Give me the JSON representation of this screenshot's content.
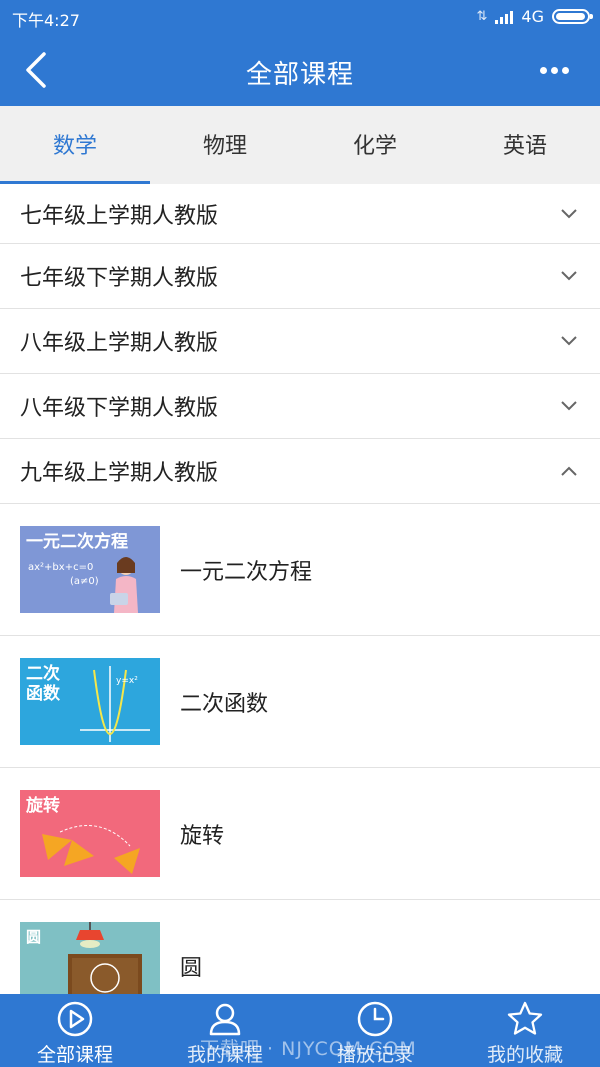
{
  "status": {
    "time": "下午4:27",
    "network": "4G",
    "battery_level": 0.95
  },
  "nav": {
    "title": "全部课程"
  },
  "tabs": [
    {
      "label": "数学",
      "active": true
    },
    {
      "label": "物理",
      "active": false
    },
    {
      "label": "化学",
      "active": false
    },
    {
      "label": "英语",
      "active": false
    }
  ],
  "grades": [
    {
      "label": "七年级上学期人教版",
      "expanded": false
    },
    {
      "label": "七年级下学期人教版",
      "expanded": false
    },
    {
      "label": "八年级上学期人教版",
      "expanded": false
    },
    {
      "label": "八年级下学期人教版",
      "expanded": false
    },
    {
      "label": "九年级上学期人教版",
      "expanded": true
    }
  ],
  "courses": [
    {
      "title": "一元二次方程",
      "thumb_caption": "一元二次方程",
      "thumb_formula": "ax²+bx+c=0",
      "thumb_note": "(a≠0)",
      "thumb_color": "#7f97d6"
    },
    {
      "title": "二次函数",
      "thumb_caption": "二次\n函数",
      "thumb_formula": "y=x²",
      "thumb_color": "#2da6dd"
    },
    {
      "title": "旋转",
      "thumb_caption": "旋转",
      "thumb_color": "#f2697c"
    },
    {
      "title": "圆",
      "thumb_caption": "圆",
      "thumb_color": "#7fc0c4"
    }
  ],
  "bottom_nav": [
    {
      "label": "全部课程",
      "icon": "play-circle-icon",
      "active": true
    },
    {
      "label": "我的课程",
      "icon": "user-icon",
      "active": false
    },
    {
      "label": "播放记录",
      "icon": "clock-icon",
      "active": false
    },
    {
      "label": "我的收藏",
      "icon": "star-icon",
      "active": false
    }
  ],
  "watermark": "下载吧 · NJYCOM.COM",
  "colors": {
    "primary": "#2f78d2",
    "divider": "#e2e2e2",
    "tab_bg": "#f0f0f0"
  }
}
